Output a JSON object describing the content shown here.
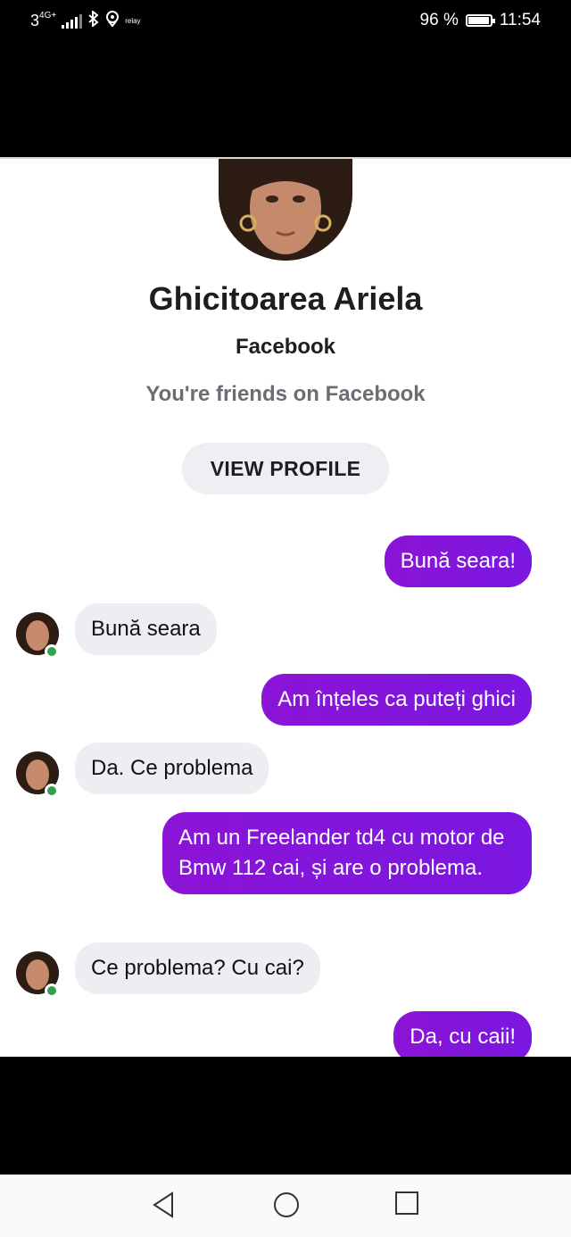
{
  "status_bar": {
    "network": "3",
    "network_type": "4G+",
    "carrier_icon": "relay",
    "battery_percent": "96 %",
    "battery_level": 0.96,
    "time": "11:54",
    "icons": [
      "signal-icon",
      "bluetooth-icon",
      "location-icon",
      "battery-icon"
    ]
  },
  "profile": {
    "name": "Ghicitoarea Ariela",
    "platform": "Facebook",
    "friends_text": "You're friends on Facebook",
    "view_profile_label": "VIEW PROFILE"
  },
  "messages": [
    {
      "direction": "out",
      "text": "Bună seara!"
    },
    {
      "direction": "in",
      "text": "Bună seara"
    },
    {
      "direction": "out",
      "text": "Am înțeles ca puteți ghici"
    },
    {
      "direction": "in",
      "text": "Da. Ce problema"
    },
    {
      "direction": "out",
      "text": "Am un Freelander td4 cu motor de Bmw 112 cai, și are o problema."
    },
    {
      "direction": "in",
      "text": "Ce problema? Cu cai?"
    },
    {
      "direction": "out",
      "text": "Da, cu caii!"
    }
  ],
  "colors": {
    "outgoing_bubble": "#7a17e0",
    "incoming_bubble": "#efedf2",
    "online_dot": "#31a24c"
  },
  "nav_bar": {
    "icons": [
      "back-icon",
      "home-icon",
      "recents-icon"
    ]
  }
}
